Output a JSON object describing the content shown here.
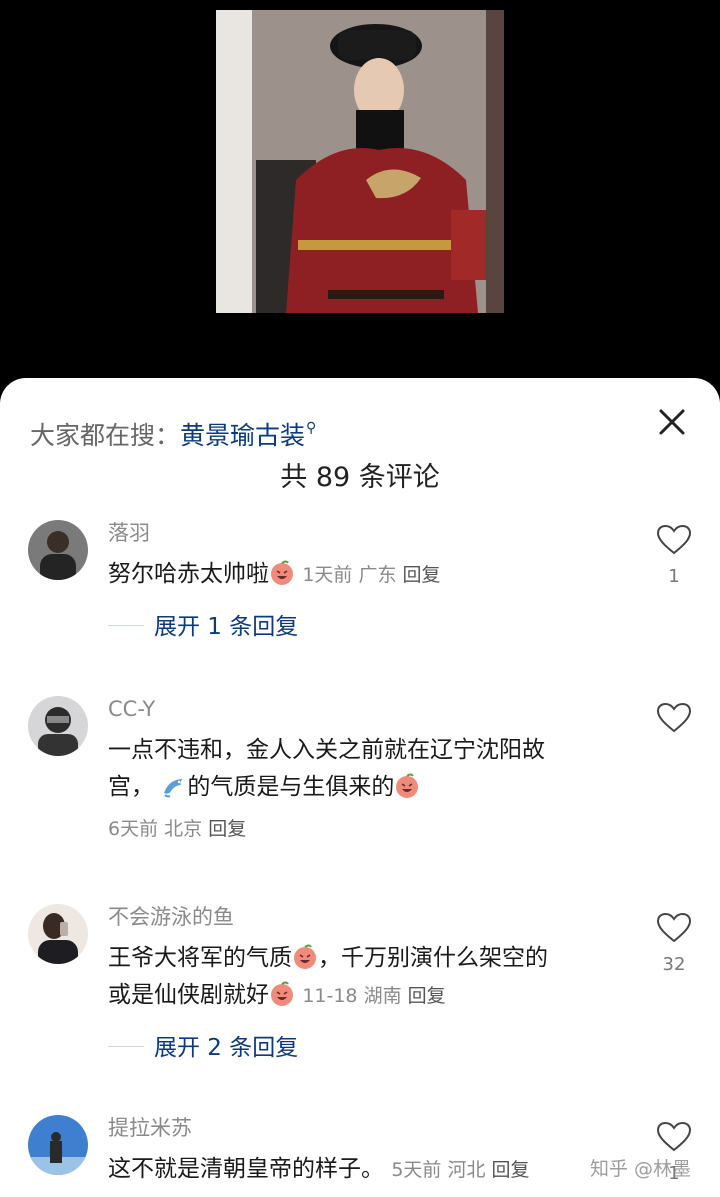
{
  "search": {
    "prefix": "大家都在搜：",
    "keyword": "黄景瑜古装"
  },
  "comment_count_title": "共 89 条评论",
  "comments": [
    {
      "user": "落羽",
      "text": "努尔哈赤太帅啦",
      "time": "1天前",
      "location": "广东",
      "reply": "回复",
      "likes": "1",
      "expand": "展开 1 条回复"
    },
    {
      "user": "CC-Y",
      "text_line1": "一点不违和，金人入关之前就在辽宁沈阳故",
      "text_line2a": "宫，",
      "text_line2b": "的气质是与生俱来的",
      "time": "6天前",
      "location": "北京",
      "reply": "回复",
      "likes": ""
    },
    {
      "user": "不会游泳的鱼",
      "text_line1a": "王爷大将军的气质",
      "text_line1b": "，千万别演什么架空的",
      "text_line2": "或是仙侠剧就好",
      "time": "11-18",
      "location": "湖南",
      "reply": "回复",
      "likes": "32",
      "expand": "展开 2 条回复"
    },
    {
      "user": "提拉米苏",
      "text": "这不就是清朝皇帝的样子。",
      "time": "5天前",
      "location": "河北",
      "reply": "回复",
      "likes": "1"
    }
  ],
  "watermark": "知乎 @林墨",
  "colors": {
    "link": "#0d3a7a",
    "meta": "#8a8a8a",
    "backdrop": "#000000",
    "sheet": "#ffffff"
  },
  "icons": [
    "close-icon",
    "heart-outline-icon",
    "laughing-peach-emoji-icon",
    "dolphin-emoji-icon",
    "search-suggest-icon"
  ]
}
